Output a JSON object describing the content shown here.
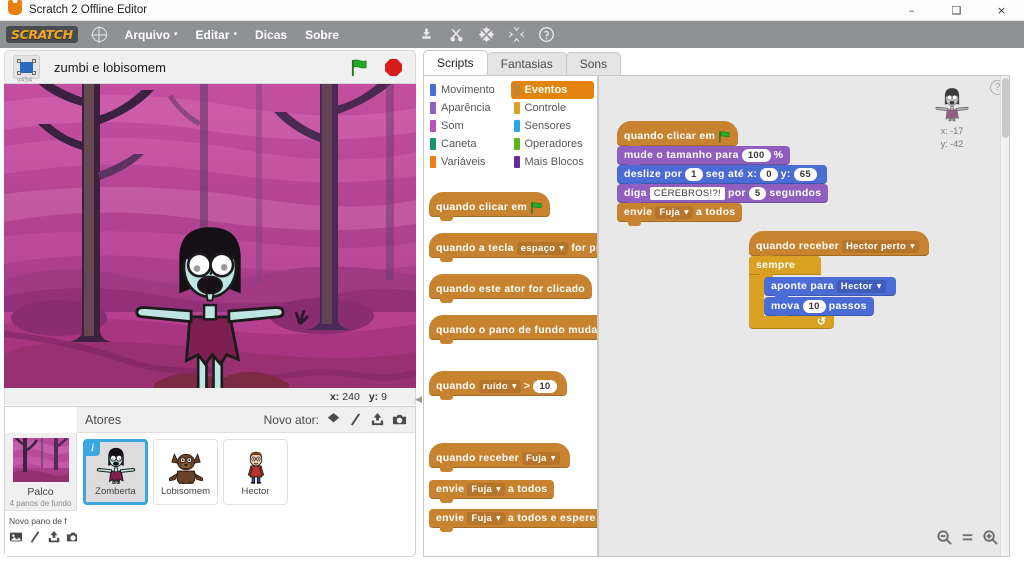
{
  "window": {
    "title": "Scratch 2 Offline Editor",
    "app_icon": "cat-icon",
    "minimize": "–",
    "maximize": "❑",
    "close": "×"
  },
  "menubar": {
    "logo": "SCRATCH",
    "globe_icon": "globe-icon",
    "items": [
      {
        "label": "Arquivo",
        "caret": "▾"
      },
      {
        "label": "Editar",
        "caret": "▾"
      },
      {
        "label": "Dicas",
        "caret": ""
      },
      {
        "label": "Sobre",
        "caret": ""
      }
    ],
    "tools": [
      {
        "name": "duplicate-icon"
      },
      {
        "name": "cut-icon"
      },
      {
        "name": "grow-icon"
      },
      {
        "name": "shrink-icon"
      },
      {
        "name": "help-icon"
      }
    ]
  },
  "stage_header": {
    "fullscreen_icon": "fullscreen-icon",
    "version": "v454",
    "project_title": "zumbi e lobisomem",
    "green_flag_icon": "green-flag-icon",
    "stop_icon": "stop-icon"
  },
  "stage": {
    "mouse_x_label": "x:",
    "mouse_x": "240",
    "mouse_y_label": "y:",
    "mouse_y": "9"
  },
  "sprite_pane": {
    "title": "Atores",
    "new_actor_label": "Novo ator:",
    "new_actor_icons": [
      "paint-icon",
      "surprise-icon",
      "upload-icon",
      "camera-icon"
    ],
    "stage_cell": {
      "name": "Palco",
      "subtitle": "4 panos de fundo"
    },
    "new_backdrop_label": "Novo pano de f",
    "new_backdrop_icons": [
      "picture-icon",
      "paint-icon",
      "upload-icon",
      "camera-icon"
    ],
    "sprites": [
      {
        "name": "Zomberta",
        "selected": true,
        "badge": "i"
      },
      {
        "name": "Lobisomem",
        "selected": false
      },
      {
        "name": "Hector",
        "selected": false
      }
    ]
  },
  "tabs": [
    {
      "label": "Scripts",
      "active": true
    },
    {
      "label": "Fantasias",
      "active": false
    },
    {
      "label": "Sons",
      "active": false
    }
  ],
  "palette": {
    "categories": [
      {
        "label": "Movimento",
        "color": "#4a6cd4",
        "active": false
      },
      {
        "label": "Eventos",
        "color": "#c88330",
        "active": true
      },
      {
        "label": "Aparência",
        "color": "#8f5ebe",
        "active": false
      },
      {
        "label": "Controle",
        "color": "#d9a022",
        "active": false
      },
      {
        "label": "Som",
        "color": "#bb4fc0",
        "active": false
      },
      {
        "label": "Sensores",
        "color": "#2ca5e2",
        "active": false
      },
      {
        "label": "Caneta",
        "color": "#0e9a6c",
        "active": false
      },
      {
        "label": "Operadores",
        "color": "#5cb712",
        "active": false
      },
      {
        "label": "Variáveis",
        "color": "#ee7d16",
        "active": false
      },
      {
        "label": "Mais Blocos",
        "color": "#632d99",
        "active": false
      }
    ],
    "blocks": [
      {
        "type": "hat",
        "parts": [
          {
            "t": "text",
            "v": "quando clicar em"
          },
          {
            "t": "flag"
          }
        ]
      },
      {
        "type": "hat",
        "parts": [
          {
            "t": "text",
            "v": "quando a tecla"
          },
          {
            "t": "drop",
            "v": "espaço"
          },
          {
            "t": "text",
            "v": "for pres"
          }
        ]
      },
      {
        "type": "hat",
        "parts": [
          {
            "t": "text",
            "v": "quando este ator for clicado"
          }
        ]
      },
      {
        "type": "hat",
        "parts": [
          {
            "t": "text",
            "v": "quando o pano de fundo mudar"
          }
        ]
      },
      {
        "type": "hat",
        "parts": [
          {
            "t": "text",
            "v": "quando"
          },
          {
            "t": "drop",
            "v": "ruído"
          },
          {
            "t": "text",
            "v": ">"
          },
          {
            "t": "oval",
            "v": "10"
          }
        ]
      },
      {
        "type": "hat",
        "parts": [
          {
            "t": "text",
            "v": "quando receber"
          },
          {
            "t": "drop",
            "v": "Fuja"
          }
        ]
      },
      {
        "type": "stack",
        "parts": [
          {
            "t": "text",
            "v": "envie"
          },
          {
            "t": "drop",
            "v": "Fuja"
          },
          {
            "t": "text",
            "v": "a todos"
          }
        ]
      },
      {
        "type": "stack",
        "parts": [
          {
            "t": "text",
            "v": "envie"
          },
          {
            "t": "drop",
            "v": "Fuja"
          },
          {
            "t": "text",
            "v": "a todos e espere"
          }
        ]
      }
    ]
  },
  "scripts": {
    "stack1": [
      {
        "cat": "events",
        "type": "hat",
        "parts": [
          {
            "t": "text",
            "v": "quando clicar em"
          },
          {
            "t": "flag"
          }
        ]
      },
      {
        "cat": "looks",
        "type": "stack",
        "parts": [
          {
            "t": "text",
            "v": "mude o tamanho para"
          },
          {
            "t": "oval",
            "v": "100"
          },
          {
            "t": "text",
            "v": "%"
          }
        ]
      },
      {
        "cat": "motion",
        "type": "stack",
        "parts": [
          {
            "t": "text",
            "v": "deslize por"
          },
          {
            "t": "oval",
            "v": "1"
          },
          {
            "t": "text",
            "v": "seg até x:"
          },
          {
            "t": "oval",
            "v": "0"
          },
          {
            "t": "text",
            "v": "y:"
          },
          {
            "t": "oval",
            "v": "65"
          }
        ]
      },
      {
        "cat": "looks",
        "type": "stack",
        "parts": [
          {
            "t": "text",
            "v": "diga"
          },
          {
            "t": "txt",
            "v": "CÉREBROS!?!"
          },
          {
            "t": "text",
            "v": "por"
          },
          {
            "t": "oval",
            "v": "5"
          },
          {
            "t": "text",
            "v": "segundos"
          }
        ]
      },
      {
        "cat": "events",
        "type": "stack",
        "parts": [
          {
            "t": "text",
            "v": "envie"
          },
          {
            "t": "drop",
            "v": "Fuja"
          },
          {
            "t": "text",
            "v": "a todos"
          }
        ]
      }
    ],
    "stack2": {
      "hat": {
        "cat": "events",
        "parts": [
          {
            "t": "text",
            "v": "quando receber"
          },
          {
            "t": "drop",
            "v": "Hector perto"
          }
        ]
      },
      "c_label": "sempre",
      "inner": [
        {
          "cat": "motion",
          "parts": [
            {
              "t": "text",
              "v": "aponte para"
            },
            {
              "t": "drop",
              "v": "Hector"
            }
          ]
        },
        {
          "cat": "motion",
          "parts": [
            {
              "t": "text",
              "v": "mova"
            },
            {
              "t": "oval",
              "v": "10"
            },
            {
              "t": "text",
              "v": "passos"
            }
          ]
        }
      ],
      "loop_arrow": "↺"
    },
    "sprite_info": {
      "x_label": "x:",
      "x_value": "-17",
      "y_label": "y:",
      "y_value": "-42"
    },
    "help_icon": "question-icon",
    "zoom_controls": [
      {
        "name": "zoom-out-icon",
        "label": "−"
      },
      {
        "name": "zoom-reset-icon",
        "label": "="
      },
      {
        "name": "zoom-in-icon",
        "label": "+"
      }
    ]
  },
  "colors": {
    "accent_orange": "#e2840d",
    "menubar_gray": "#8f9194",
    "events": "#c88330",
    "control": "#d9a022",
    "looks": "#8f5ebe",
    "motion": "#4a6cd4",
    "stage_purple": "#b53f93",
    "select_blue": "#3ba7e0"
  }
}
